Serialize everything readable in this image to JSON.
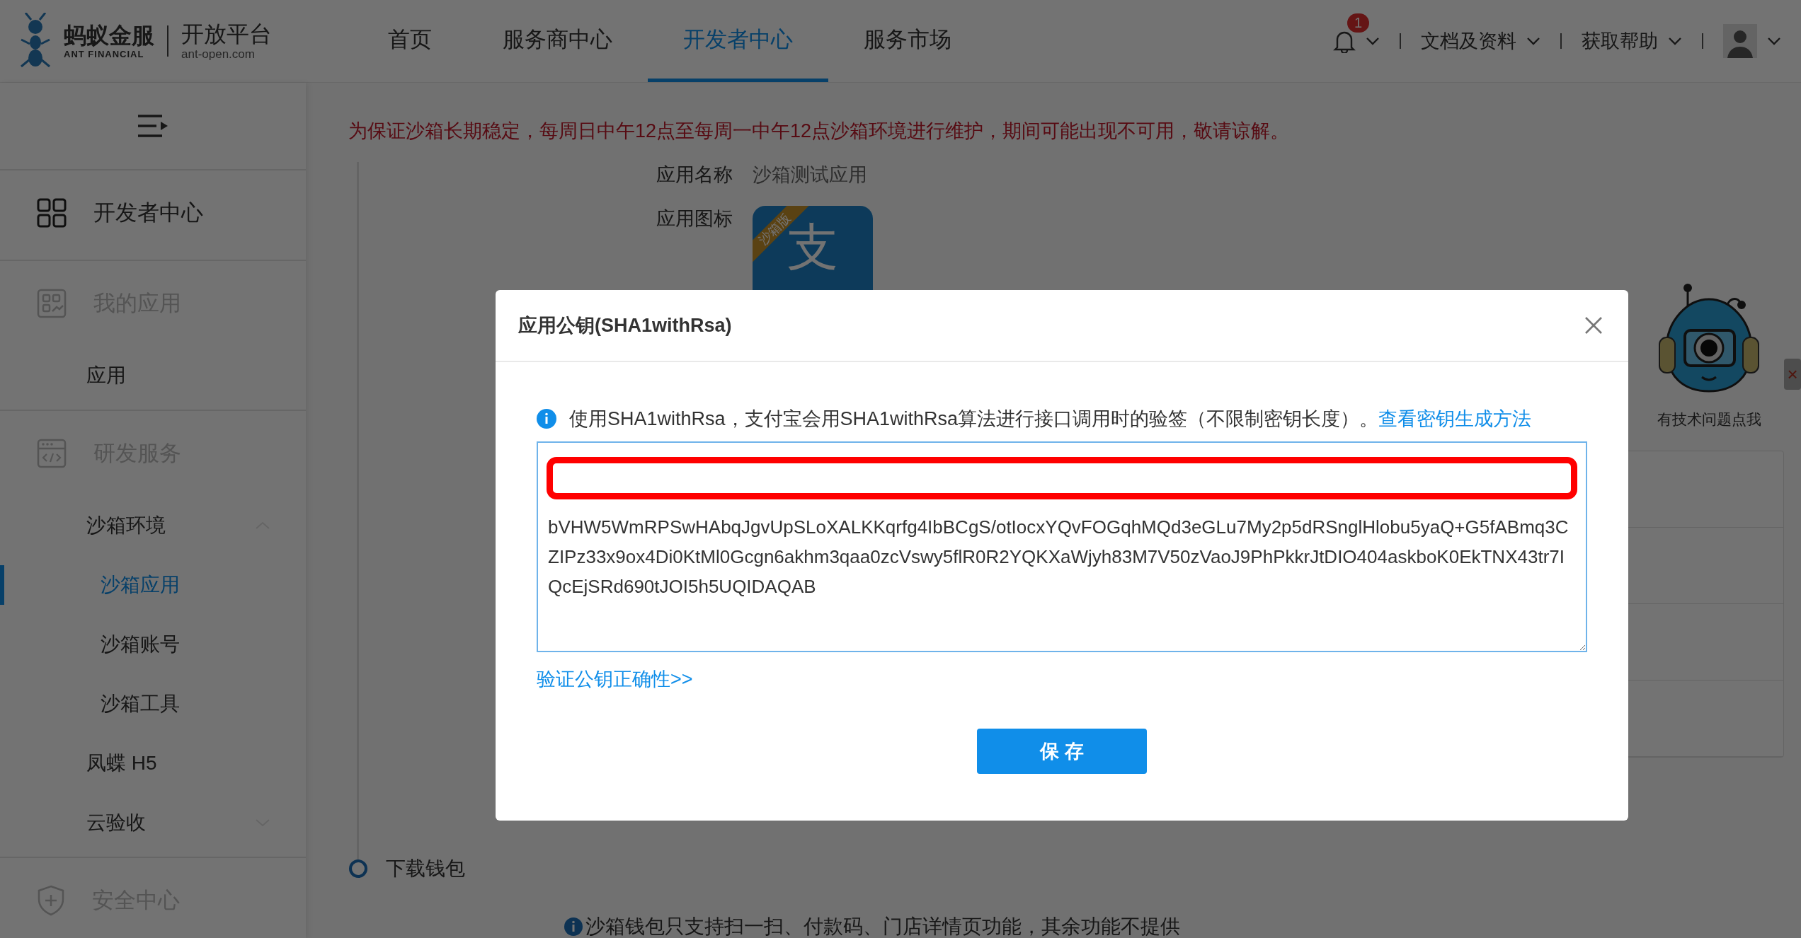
{
  "header": {
    "logo": {
      "brand": "蚂蚁金服",
      "brand_sub": "ANT FINANCIAL",
      "platform": "开放平台",
      "domain": "ant-open.com"
    },
    "nav": [
      {
        "label": "首页",
        "selected": false
      },
      {
        "label": "服务商中心",
        "selected": false
      },
      {
        "label": "开发者中心",
        "selected": true
      },
      {
        "label": "服务市场",
        "selected": false
      }
    ],
    "notification_count": "1",
    "menus": [
      "文档及资料",
      "获取帮助"
    ]
  },
  "sidebar": {
    "groups": [
      {
        "title": "开发者中心",
        "kind": "grid",
        "enabled": true
      },
      {
        "title": "我的应用",
        "kind": "apps",
        "enabled": false,
        "items": [
          {
            "label": "应用",
            "selected": false
          }
        ]
      },
      {
        "title": "研发服务",
        "kind": "code",
        "enabled": false,
        "items": [
          {
            "label": "沙箱环境",
            "selected": false,
            "expanded": true,
            "children": [
              {
                "label": "沙箱应用",
                "selected": true
              },
              {
                "label": "沙箱账号",
                "selected": false
              },
              {
                "label": "沙箱工具",
                "selected": false
              }
            ]
          },
          {
            "label": "凤蝶 H5",
            "selected": false
          },
          {
            "label": "云验收",
            "selected": false,
            "expanded": false
          }
        ]
      },
      {
        "title": "安全中心",
        "kind": "shield",
        "enabled": false
      }
    ]
  },
  "main": {
    "notice": "为保证沙箱长期稳定，每周日中午12点至每周一中午12点沙箱环境进行维护，期间可能出现不可用，敬请谅解。",
    "fields": [
      {
        "label": "应用名称",
        "kind": "text",
        "value": "沙箱测试应用"
      },
      {
        "label": "应用图标",
        "kind": "icon",
        "badge": "沙箱版",
        "glyph": "支"
      }
    ],
    "steps": [
      {
        "label": "下载钱包"
      }
    ],
    "wallet_note": "沙箱钱包只支持扫一扫、付款码、门店详情页功能，其余功能不提供"
  },
  "helper": {
    "label": "有技术问题点我",
    "close": "×"
  },
  "modal": {
    "title": "应用公钥(SHA1withRsa)",
    "info": "使用SHA1withRsa，支付宝会用SHA1withRsa算法进行接口调用时的验签（不限制密钥长度）。",
    "info_link": "查看密钥生成方法",
    "key_value": "bVHW5WmRPSwHAbqJgvUpSLoXALKKqrfg4IbBCgS/otIocxYQvFOGqhMQd3eGLu7My2p5dRSnglHlobu5yaQ+G5fABmq3CZIPz33x9ox4Di0KtMl0Gcgn6akhm3qaa0zcVswy5flR0R2YQKXaWjyh83M7V50zVaoJ9PhPkkrJtDIO404askboK0EkTNX43tr7IQcEjSRd690tJOI5h5UQIDAQAB",
    "verify_link": "验证公钥正确性>>",
    "save": "保 存"
  }
}
